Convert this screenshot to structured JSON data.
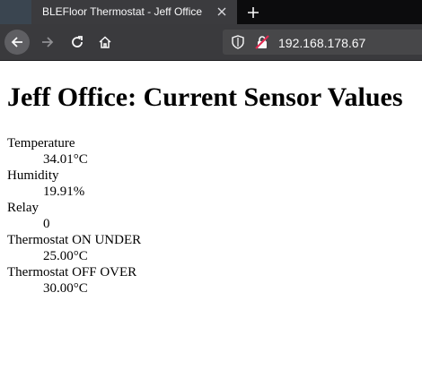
{
  "browser": {
    "tab_title": "BLEFloor Thermostat - Jeff Office",
    "url": "192.168.178.67"
  },
  "page": {
    "heading": "Jeff Office: Current Sensor Values",
    "readings": [
      {
        "label": "Temperature",
        "value": "34.01°C"
      },
      {
        "label": "Humidity",
        "value": "19.91%"
      },
      {
        "label": "Relay",
        "value": "0"
      },
      {
        "label": "Thermostat ON UNDER",
        "value": "25.00°C"
      },
      {
        "label": "Thermostat OFF OVER",
        "value": "30.00°C"
      }
    ]
  }
}
